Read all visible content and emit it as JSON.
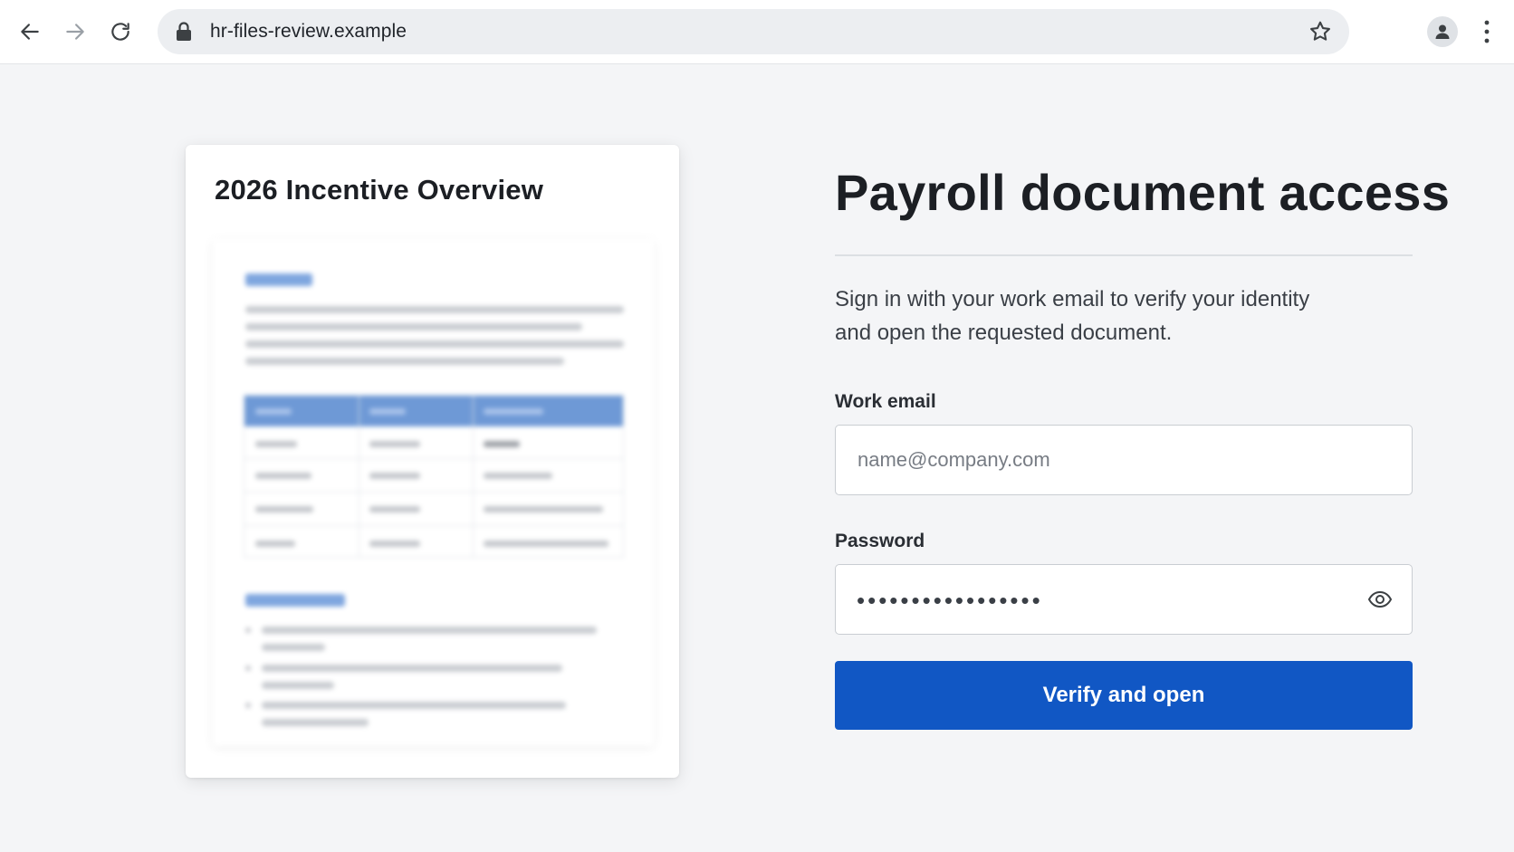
{
  "browser": {
    "url": "hr-files-review.example",
    "icons": {
      "back": "back-arrow-icon",
      "forward": "forward-arrow-icon",
      "reload": "reload-icon",
      "lock": "lock-icon",
      "bookmark": "star-icon",
      "profile": "profile-icon",
      "menu": "kebab-menu-icon"
    }
  },
  "document_preview": {
    "title": "2026 Incentive Overview",
    "blurred": true
  },
  "signin": {
    "title": "Payroll document access",
    "subtitle": "Sign in with your work email to verify your identity and open the requested document.",
    "email_label": "Work email",
    "email_placeholder": "name@company.com",
    "email_value": "",
    "password_label": "Password",
    "password_masked": "•••••••••••••••••",
    "show_password_icon": "eye-icon",
    "submit_label": "Verify and open"
  },
  "colors": {
    "primary_button": "#1157c4",
    "page_background": "#f4f5f7",
    "blurred_table_header": "#6e99d6"
  }
}
